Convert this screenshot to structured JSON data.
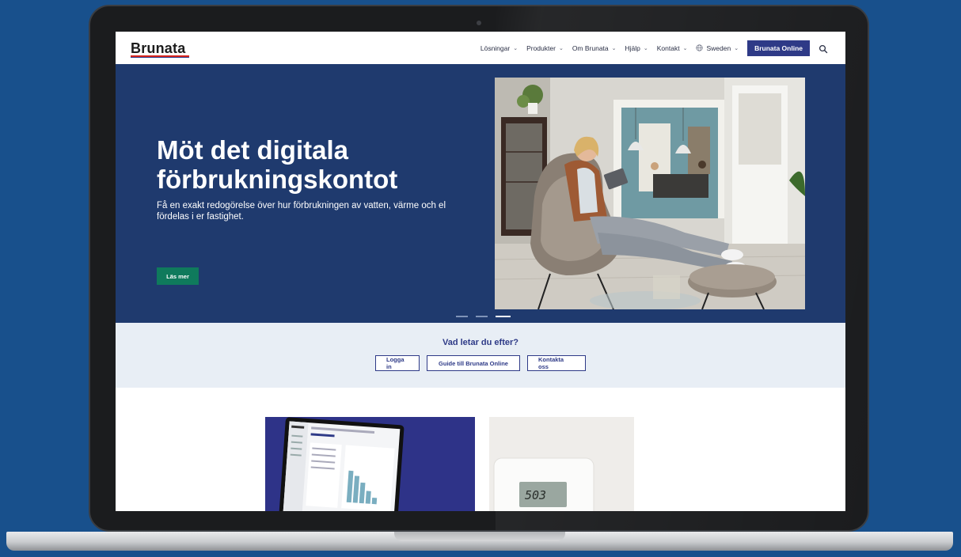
{
  "header": {
    "logo_text": "Brunata",
    "nav": [
      {
        "label": "Lösningar"
      },
      {
        "label": "Produkter"
      },
      {
        "label": "Om Brunata"
      },
      {
        "label": "Hjälp"
      },
      {
        "label": "Kontakt"
      }
    ],
    "region_label": "Sweden",
    "online_button": "Brunata Online"
  },
  "hero": {
    "title_line1": "Möt det digitala",
    "title_line2": "förbrukningskontot",
    "text": "Få en exakt redogörelse över hur förbrukningen av vatten, värme och el fördelas i er fastighet.",
    "cta": "Läs mer",
    "slides_count": 3,
    "active_slide": 3
  },
  "quick_links": {
    "title": "Vad letar du efter?",
    "buttons": [
      "Logga in",
      "Guide till Brunata Online",
      "Kontakta oss"
    ]
  },
  "cards": {
    "meter_reading": "503"
  },
  "colors": {
    "background": "#18508c",
    "hero": "#1f3a6e",
    "brand_blue": "#2e3a87",
    "cta_green": "#0f7a5c",
    "quick_bg": "#e8eef5"
  }
}
